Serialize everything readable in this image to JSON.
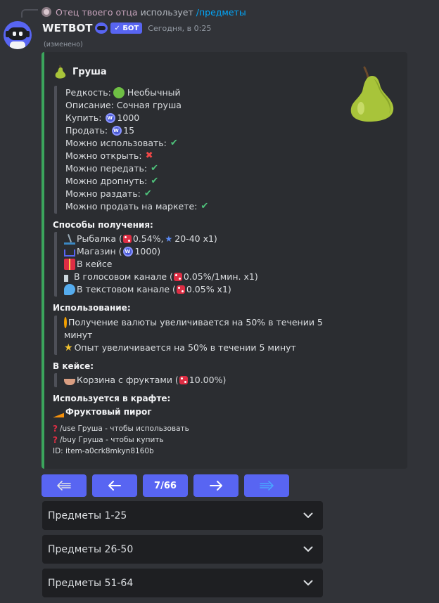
{
  "reply": {
    "user": "Отец твоего отца",
    "verb": "использует",
    "command": "/предметы"
  },
  "message": {
    "author": "WETBOT",
    "badge": "✓ БОТ",
    "timestamp": "Сегодня, в 0:25",
    "edited": "(изменено)"
  },
  "embed": {
    "accent_color": "#3ba55c",
    "title": "Груша",
    "title_icon": "pear-icon",
    "properties": [
      {
        "label": "Редкость:",
        "value": "Необычный",
        "icon": "green-circle-icon"
      },
      {
        "label": "Описание:",
        "value": "Сочная груша"
      },
      {
        "label": "Купить:",
        "value": "1000",
        "icon": "coin-icon"
      },
      {
        "label": "Продать:",
        "value": "15",
        "icon": "coin-icon"
      },
      {
        "label": "Можно использовать:",
        "flag": "✔"
      },
      {
        "label": "Можно открыть:",
        "flag": "✖"
      },
      {
        "label": "Можно передать:",
        "flag": "✔"
      },
      {
        "label": "Можно дропнуть:",
        "flag": "✔"
      },
      {
        "label": "Можно раздать:",
        "flag": "✔"
      },
      {
        "label": "Можно продать на маркете:",
        "flag": "✔"
      }
    ],
    "obtain": {
      "heading": "Способы получения:",
      "fishing": {
        "label": "Рыбалка (",
        "chance": "0.54%,",
        "range": "20-40 x1)"
      },
      "shop": {
        "label": "Магазин (",
        "price": "1000",
        "close": ")"
      },
      "case": {
        "label": "В кейсе"
      },
      "voice": {
        "label": "В голосовом канале (",
        "chance": "0.05%/1мин. x1)"
      },
      "text": {
        "label": "В текстовом канале (",
        "chance": "0.05% x1)"
      }
    },
    "usage": {
      "heading": "Использование:",
      "line1a": "Получение валюты увеличивается на 50% в течении 5",
      "line1b": "минут",
      "line2": "Опыт увеличивается на 50% в течении 5 минут"
    },
    "in_case": {
      "heading": "В кейсе:",
      "label": "Корзина с фруктами (",
      "chance": "10.00%)"
    },
    "craft": {
      "heading": "Используется в крафте:",
      "item": "Фруктовый пирог"
    },
    "footer": {
      "use": "/use Груша - чтобы использовать",
      "buy": "/buy Груша - чтобы купить",
      "id": "ID: item-a0crk8mkyn8160b"
    }
  },
  "pagination": {
    "page": "7/66",
    "button_color": "#5865f2"
  },
  "selects": [
    {
      "label": "Предметы 1-25"
    },
    {
      "label": "Предметы 26-50"
    },
    {
      "label": "Предметы 51-64"
    }
  ]
}
